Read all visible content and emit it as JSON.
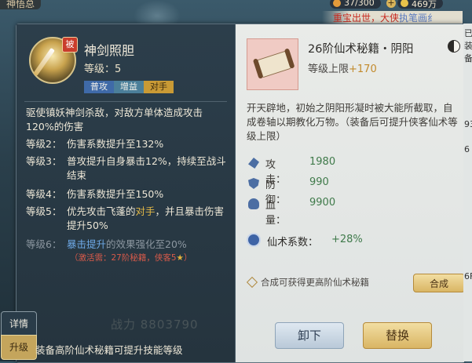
{
  "top_bar": {
    "left_title": "神悟总",
    "stamina": "37/300",
    "gold": "469万",
    "banner_prefix": "重宝出世，大侠",
    "banner_highlight": "执笔画纟"
  },
  "skill": {
    "passive_badge": "被",
    "name": "神剑照胆",
    "level": "等级：5",
    "tags": [
      "普攻",
      "增益",
      "对手"
    ],
    "description": "驱使镇妖神剑杀敌，对敌方单体造成攻击120%的伤害",
    "levels": [
      {
        "label": "等级2：",
        "text": "伤害系数提升至132%"
      },
      {
        "label": "等级3：",
        "text": "普攻提升自身暴击12%，持续至战斗结束"
      },
      {
        "label": "等级4：",
        "text": "伤害系数提升至150%"
      },
      {
        "label": "等级5：",
        "text_pre": "优先攻击飞蓬的",
        "text_hl": "对手",
        "text_post": "，并且暴击伤害提升50%"
      },
      {
        "label": "等级6：",
        "text_hl": "暴击提升",
        "text_post": "的效果强化至20%"
      }
    ],
    "requirement": "（激活需：27阶秘籍，侠客5",
    "requirement_end": "）"
  },
  "bg_power": "战力 8803790",
  "side_tabs": {
    "detail": "详情",
    "upgrade": "升级"
  },
  "footer_tip": "装备高阶仙术秘籍可提升技能等级",
  "book": {
    "name": "26阶仙术秘籍・阴阳",
    "level_cap_label": "等级上限",
    "level_cap_value": "+170",
    "description": "开天辟地，初始之阴阳形凝时被大能所截取，自成卷轴以期教化万物。（装备后可提升侠客仙术等级上限）",
    "stats": [
      {
        "label": "攻击：",
        "value": "1980",
        "icon": "attack-icon"
      },
      {
        "label": "防御：",
        "value": "990",
        "icon": "defense-icon"
      },
      {
        "label": "血量：",
        "value": "9900",
        "icon": "hp-icon"
      }
    ],
    "coef_label": "仙术系数：",
    "coef_value": "+28%",
    "synth_tip": "合成可获得更高阶仙术秘籍",
    "synth_button": "合成",
    "unequip_button": "卸下",
    "replace_button": "替换"
  },
  "edge_chars": [
    "已",
    "装",
    "备",
    "93",
    "6",
    "6F"
  ]
}
